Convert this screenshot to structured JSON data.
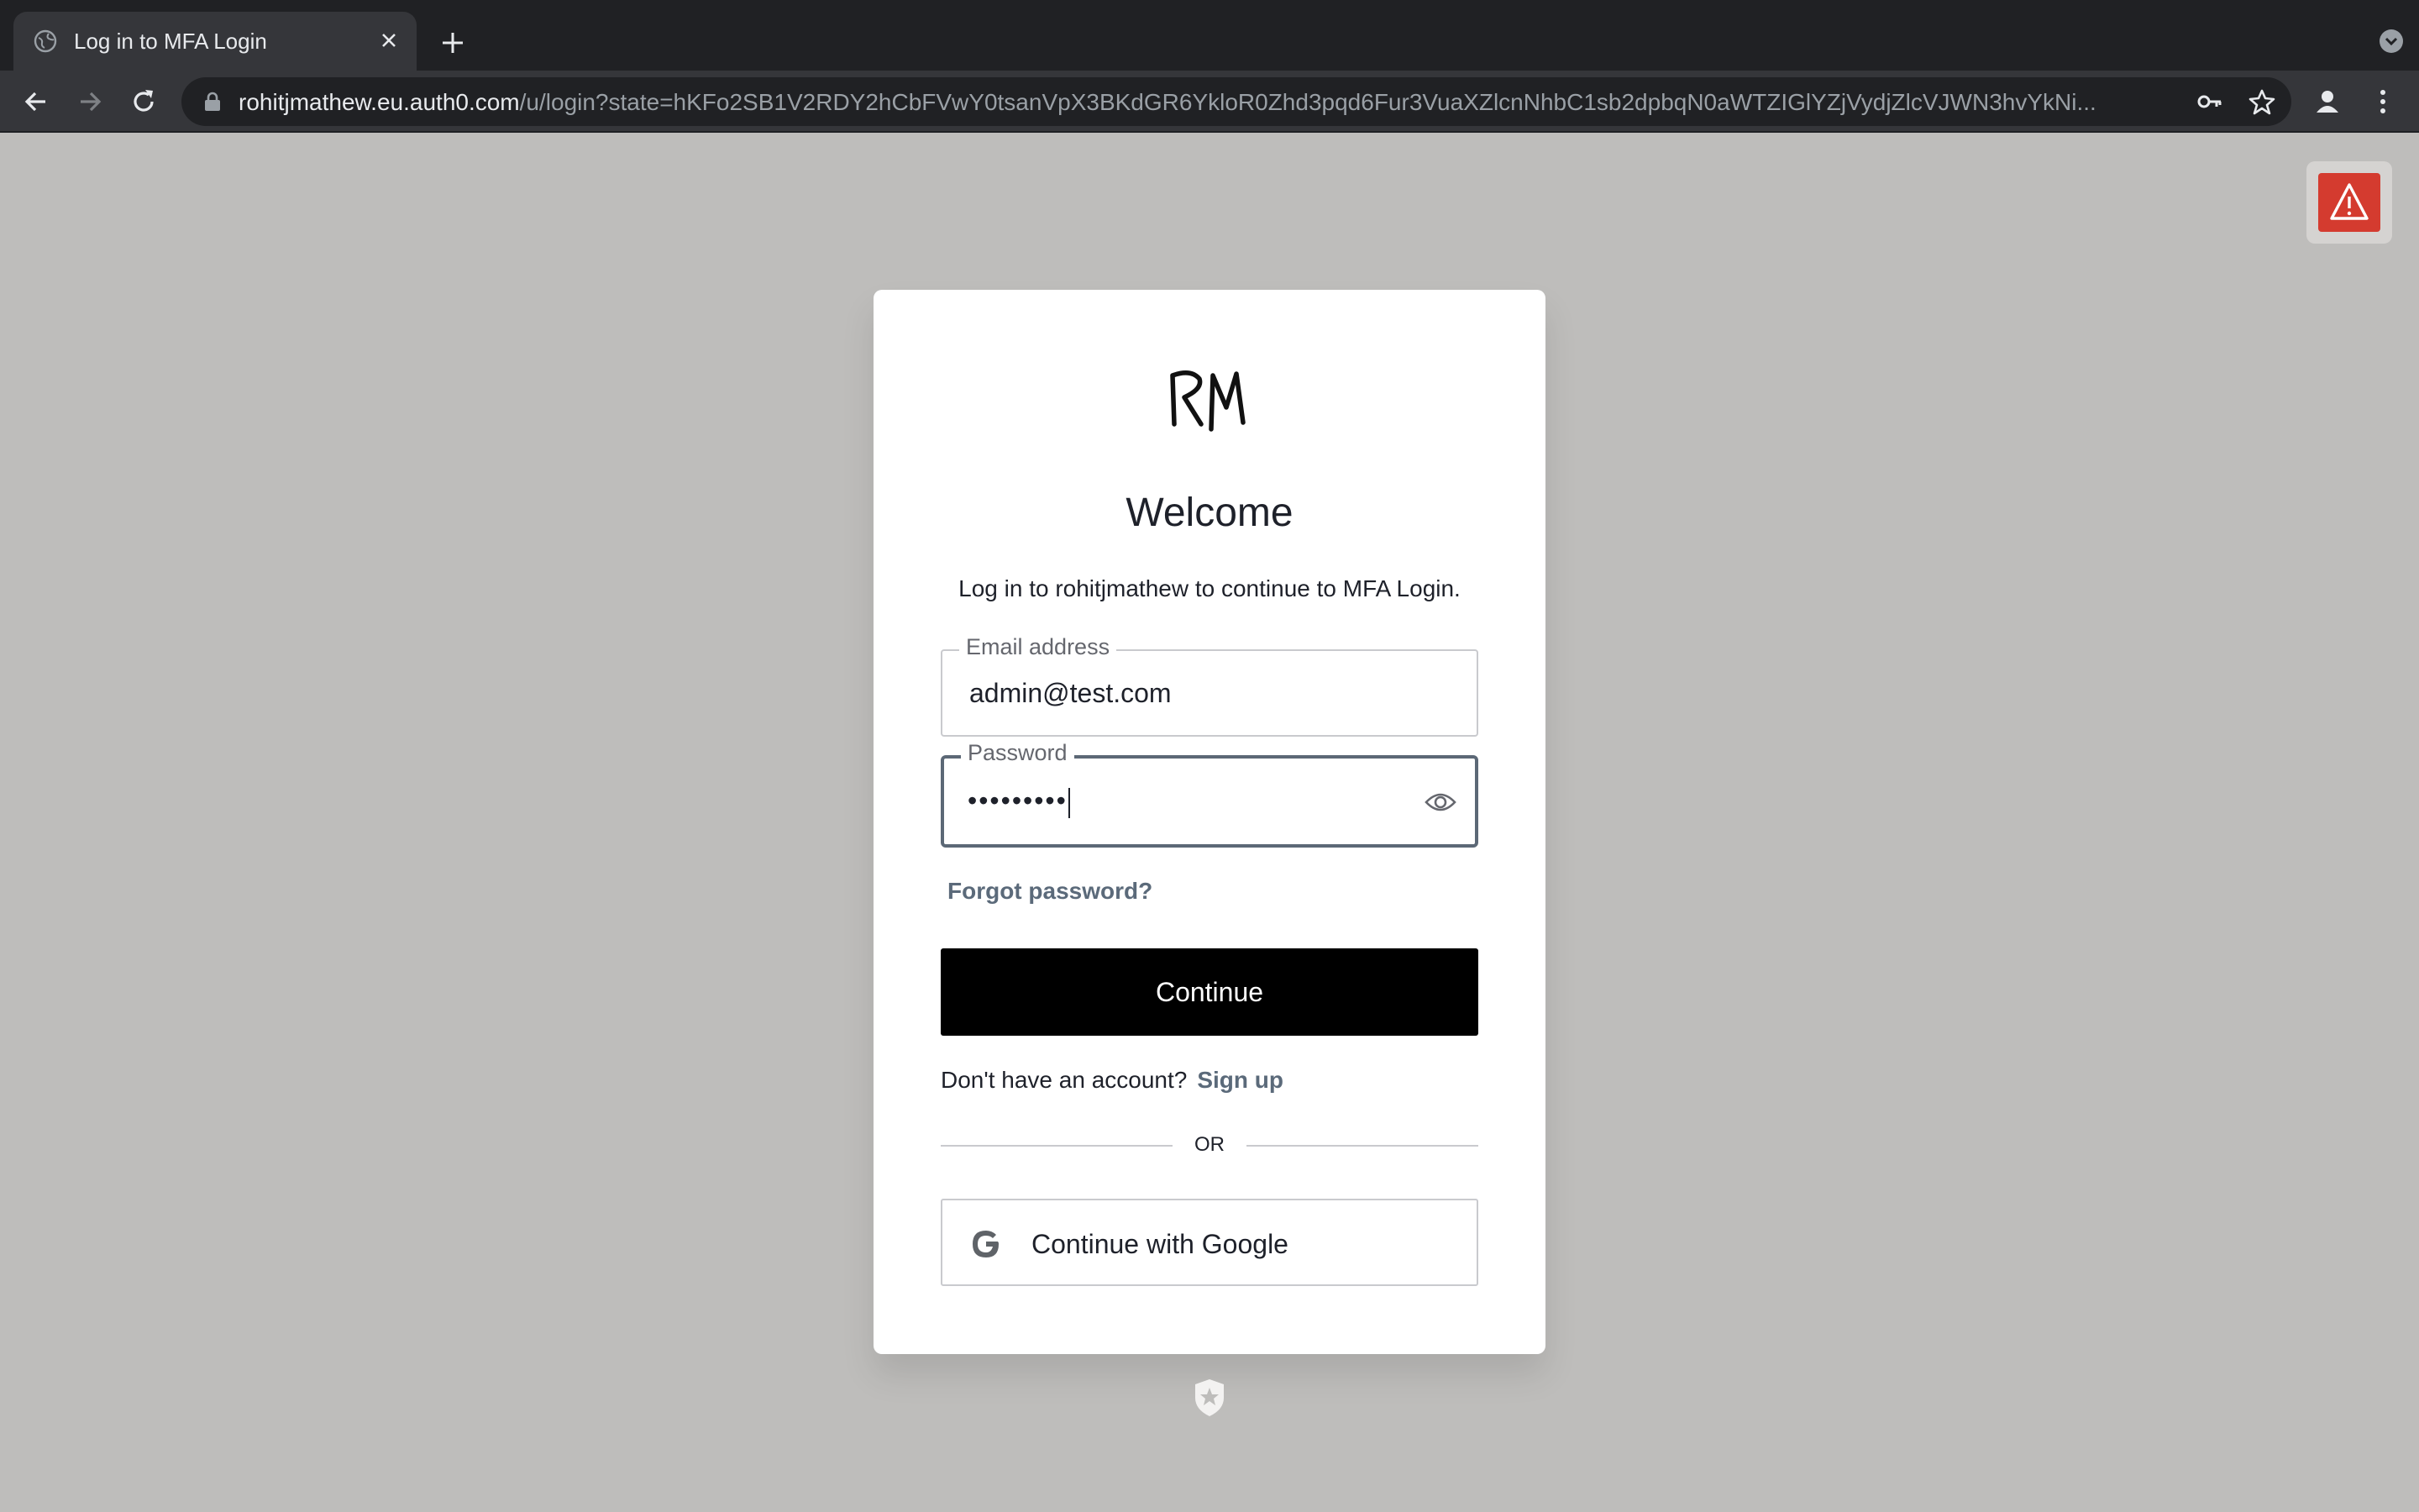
{
  "browser": {
    "tab_title": "Log in to MFA Login",
    "url_host": "rohitjmathew.eu.auth0.com",
    "url_path": "/u/login?state=hKFo2SB1V2RDY2hCbFVwY0tsanVpX3BKdGR6YkloR0Zhd3pqd6Fur3VuaXZlcnNhbC1sb2dpbqN0aWTZIGlYZjVydjZlcVJWN3hvYkNi..."
  },
  "login": {
    "logo_text": "RM",
    "heading": "Welcome",
    "subtitle": "Log in to rohitjmathew to continue to MFA Login.",
    "email_label": "Email address",
    "email_value": "admin@test.com",
    "password_label": "Password",
    "password_value": "•••••••••",
    "forgot_password": "Forgot password?",
    "continue_label": "Continue",
    "no_account_text": "Don't have an account?",
    "signup_label": "Sign up",
    "or_text": "OR",
    "google_label": "Continue with Google"
  },
  "icons": {
    "warning": "warning-icon",
    "eye": "eye-icon",
    "google": "google-icon",
    "auth0_badge": "auth0-badge-icon"
  },
  "colors": {
    "warning_bg": "#d43b2f",
    "continue_bg": "#000000",
    "link": "#5b6a7a",
    "page_bg": "#bebdbb"
  }
}
